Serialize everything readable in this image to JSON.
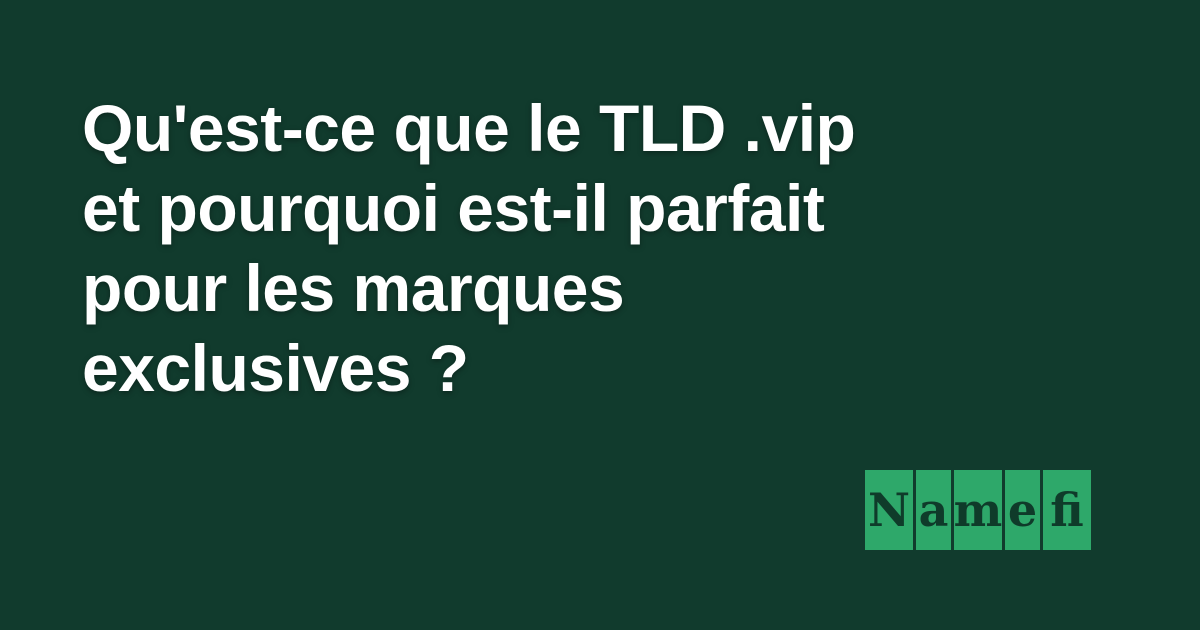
{
  "colors": {
    "background": "#113b2d",
    "headline_text": "#ffffff",
    "logo_tile": "#2ea86a",
    "logo_text": "#0f3b2a"
  },
  "headline": {
    "lines": [
      "Qu'est-ce que le TLD .vip",
      "et pourquoi est-il parfait",
      "pour les marques",
      "exclusives ?"
    ]
  },
  "brand": {
    "name": "Namefi",
    "letters": [
      "N",
      "a",
      "m",
      "e",
      "fi"
    ]
  }
}
